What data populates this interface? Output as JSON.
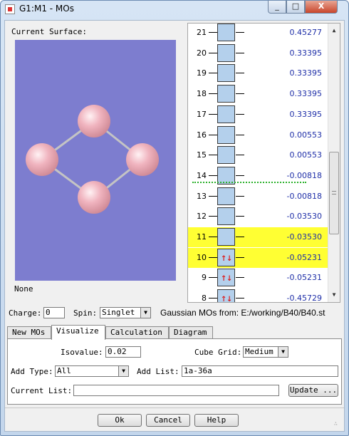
{
  "window": {
    "title": "G1:M1 - MOs",
    "minimize_label": "_",
    "maximize_label": "□",
    "close_label": "X"
  },
  "surface": {
    "label": "Current Surface:",
    "value": "None"
  },
  "mo_list": {
    "rows": [
      {
        "num": "21",
        "energy": "0.45277",
        "occupancy": 0,
        "highlight": false
      },
      {
        "num": "20",
        "energy": "0.33395",
        "occupancy": 0,
        "highlight": false
      },
      {
        "num": "19",
        "energy": "0.33395",
        "occupancy": 0,
        "highlight": false
      },
      {
        "num": "18",
        "energy": "0.33395",
        "occupancy": 0,
        "highlight": false
      },
      {
        "num": "17",
        "energy": "0.33395",
        "occupancy": 0,
        "highlight": false
      },
      {
        "num": "16",
        "energy": "0.00553",
        "occupancy": 0,
        "highlight": false
      },
      {
        "num": "15",
        "energy": "0.00553",
        "occupancy": 0,
        "highlight": false
      },
      {
        "num": "14",
        "energy": "-0.00818",
        "occupancy": 0,
        "highlight": false
      },
      {
        "num": "13",
        "energy": "-0.00818",
        "occupancy": 0,
        "highlight": false
      },
      {
        "num": "12",
        "energy": "-0.03530",
        "occupancy": 0,
        "highlight": false
      },
      {
        "num": "11",
        "energy": "-0.03530",
        "occupancy": 0,
        "highlight": true
      },
      {
        "num": "10",
        "energy": "-0.05231",
        "occupancy": 2,
        "highlight": true
      },
      {
        "num": "9",
        "energy": "-0.05231",
        "occupancy": 2,
        "highlight": false
      },
      {
        "num": "8",
        "energy": "-0.45729",
        "occupancy": 2,
        "highlight": false
      }
    ],
    "scroll_up": "▲",
    "scroll_down": "▼"
  },
  "controls": {
    "charge_label": "Charge:",
    "charge_value": "0",
    "spin_label": "Spin:",
    "spin_value": "Singlet",
    "source_label": "Gaussian MOs from:  E:/working/B40/B40.st"
  },
  "tabs": [
    {
      "label": "New MOs",
      "active": false
    },
    {
      "label": "Visualize",
      "active": true
    },
    {
      "label": "Calculation",
      "active": false
    },
    {
      "label": "Diagram",
      "active": false
    }
  ],
  "visualize": {
    "isovalue_label": "Isovalue:",
    "isovalue_value": "0.02",
    "cube_grid_label": "Cube Grid:",
    "cube_grid_value": "Medium",
    "add_type_label": "Add Type:",
    "add_type_value": "All",
    "add_list_label": "Add List:",
    "add_list_value": "1a-36a",
    "current_list_label": "Current List:",
    "current_list_value": "",
    "update_label": "Update ..."
  },
  "footer": {
    "ok_label": "Ok",
    "cancel_label": "Cancel",
    "help_label": "Help"
  },
  "colors": {
    "surface_background": "#7d7dcf",
    "atom": "#f0b4bf",
    "orbital_box": "#b4d0ec",
    "highlight": "#ffff33",
    "energy_text": "#1f2fa8",
    "electron_arrow": "#dd1111",
    "homo_lumo_separator": "#2bb02b"
  }
}
